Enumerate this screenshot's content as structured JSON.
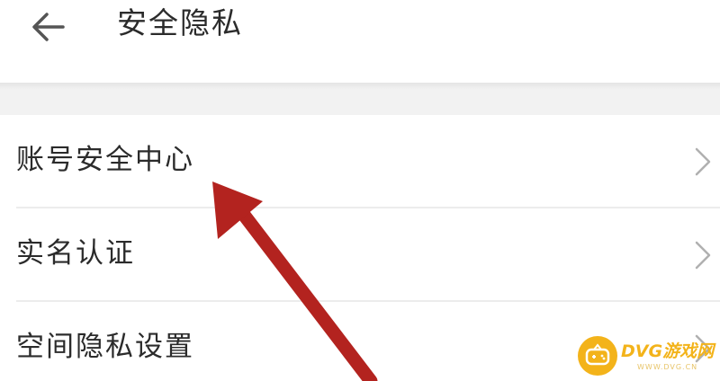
{
  "header": {
    "back_icon": "back-arrow-icon",
    "title": "安全隐私"
  },
  "settings": {
    "items": [
      {
        "label": "账号安全中心",
        "icon": "chevron-right-icon"
      },
      {
        "label": "实名认证",
        "icon": "chevron-right-icon"
      },
      {
        "label": "空间隐私设置",
        "icon": "chevron-right-icon"
      }
    ]
  },
  "annotation": {
    "arrow_color": "#b3231f"
  },
  "watermark": {
    "text": "DVG游戏网",
    "sub": "WWW.DVG.CN",
    "color": "#f3b31a"
  }
}
